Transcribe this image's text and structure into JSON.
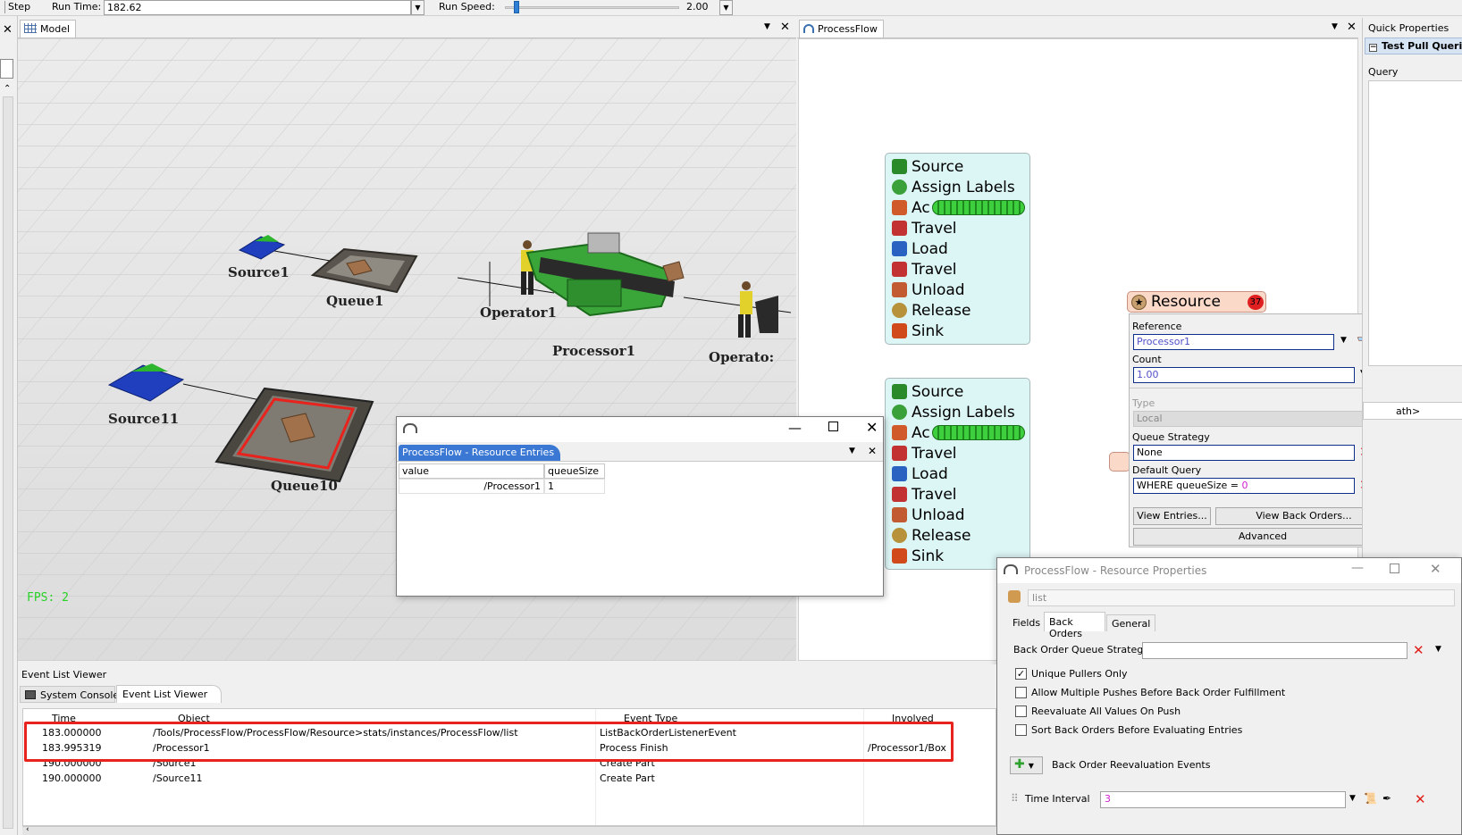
{
  "toolbar": {
    "step_label": "Step",
    "run_time_label": "Run Time:",
    "run_time_value": "182.62",
    "run_speed_label": "Run Speed:",
    "run_speed_value": "2.00",
    "run_speed_level": 0.05
  },
  "model_tab": {
    "label": "Model"
  },
  "model_view": {
    "objects": [
      "Source1",
      "Queue1",
      "Operator1",
      "Processor1",
      "Operato:",
      "Source11",
      "Queue10"
    ],
    "fps": "FPS: 2"
  },
  "processflow_tab": {
    "label": "ProcessFlow"
  },
  "quick_properties": {
    "title": "Quick Properties",
    "section": "Test Pull Querie",
    "query_label": "Query",
    "path_text": "ath>"
  },
  "flow_blocks": [
    {
      "items": [
        "Source",
        "Assign Labels",
        "Ac",
        "Travel",
        "Load",
        "Travel",
        "Unload",
        "Release",
        "Sink"
      ]
    },
    {
      "items": [
        "Source",
        "Assign Labels",
        "Ac",
        "Travel",
        "Load",
        "Travel",
        "Unload",
        "Release",
        "Sink"
      ]
    }
  ],
  "resource": {
    "title": "Resource",
    "badge": "37",
    "reference_label": "Reference",
    "reference_value": "Processor1",
    "count_label": "Count",
    "count_value": "1.00",
    "type_label": "Type",
    "type_value": "Local",
    "queue_strategy_label": "Queue Strategy",
    "queue_strategy_value": "None",
    "default_query_label": "Default Query",
    "default_query_prefix": "WHERE queueSize = ",
    "default_query_num": "0",
    "view_entries": "View Entries...",
    "view_back_orders": "View Back Orders...",
    "advanced": "Advanced"
  },
  "entries_window": {
    "tab_title": "ProcessFlow - Resource Entries",
    "columns": [
      "value",
      "queueSize"
    ],
    "rows": [
      [
        "/Processor1",
        "1"
      ]
    ]
  },
  "resource_props_window": {
    "title": "ProcessFlow - Resource Properties",
    "name_value": "list",
    "tabs": [
      "Fields",
      "Back Orders",
      "General"
    ],
    "active_tab": "Back Orders",
    "bo_queue_strategy_label": "Back Order Queue Strategy",
    "options": [
      {
        "label": "Unique Pullers Only",
        "checked": true
      },
      {
        "label": "Allow Multiple Pushes Before Back Order Fulfillment",
        "checked": false
      },
      {
        "label": "Reevaluate All Values On Push",
        "checked": false
      },
      {
        "label": "Sort Back Orders Before Evaluating Entries",
        "checked": false
      }
    ],
    "reeval_events_label": "Back Order Reevaluation Events",
    "time_interval_label": "Time Interval",
    "time_interval_value": "3"
  },
  "event_list": {
    "panel_title": "Event List Viewer",
    "tabs": [
      "System Console",
      "Event List Viewer"
    ],
    "columns": [
      "Time",
      "Object",
      "Event Type",
      "Involved"
    ],
    "rows": [
      [
        "183.000000",
        "/Tools/ProcessFlow/ProcessFlow/Resource>stats/instances/ProcessFlow/list",
        "ListBackOrderListenerEvent",
        ""
      ],
      [
        "183.995319",
        "/Processor1",
        "Process Finish",
        "/Processor1/Box"
      ],
      [
        "190.000000",
        "/Source1",
        "Create Part",
        ""
      ],
      [
        "190.000000",
        "/Source11",
        "Create Part",
        ""
      ]
    ]
  },
  "colors": {
    "highlight": "#e8231d",
    "token_green": "#3dcf3d",
    "block_bg": "#dcf5f5"
  }
}
